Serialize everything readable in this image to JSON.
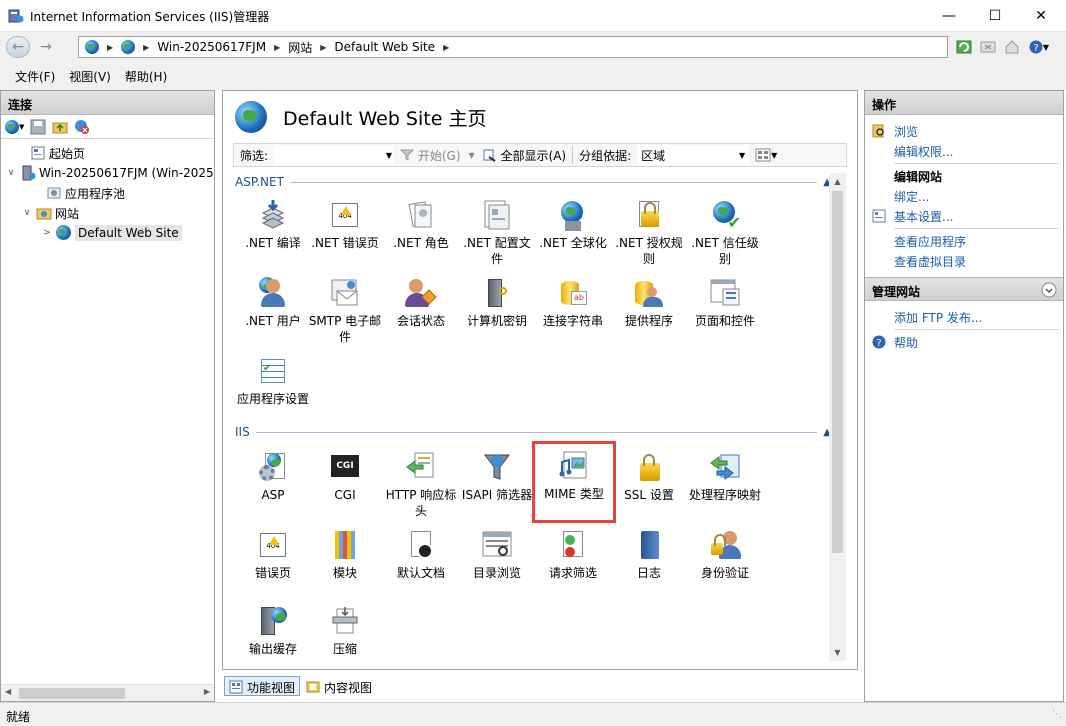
{
  "window": {
    "title": "Internet Information Services (IIS)管理器"
  },
  "address": {
    "crumbs": [
      "Win-20250617FJM",
      "网站",
      "Default Web Site"
    ]
  },
  "menu": [
    "文件(F)",
    "视图(V)",
    "帮助(H)"
  ],
  "connections": {
    "header": "连接",
    "tree": {
      "start": "起始页",
      "server": "Win-20250617FJM (Win-2025",
      "apppools": "应用程序池",
      "sites": "网站",
      "site": "Default Web Site"
    }
  },
  "center": {
    "title": "Default Web Site 主页",
    "filter": {
      "label": "筛选:",
      "start": "开始(G)",
      "showall": "全部显示(A)",
      "groupby": "分组依据:",
      "groupvalue": "区域"
    },
    "groups": {
      "aspnet": "ASP.NET",
      "iis": "IIS"
    },
    "aspnet_items": [
      ".NET 编译",
      ".NET 错误页",
      ".NET 角色",
      ".NET 配置文件",
      ".NET 全球化",
      ".NET 授权规则",
      ".NET 信任级别",
      ".NET 用户",
      "SMTP 电子邮件",
      "会话状态",
      "计算机密钥",
      "连接字符串",
      "提供程序",
      "页面和控件",
      "应用程序设置"
    ],
    "iis_items": [
      "ASP",
      "CGI",
      "HTTP 响应标头",
      "ISAPI 筛选器",
      "MIME 类型",
      "SSL 设置",
      "处理程序映射",
      "错误页",
      "模块",
      "默认文档",
      "目录浏览",
      "请求筛选",
      "日志",
      "身份验证",
      "输出缓存",
      "压缩"
    ],
    "tabs": {
      "features": "功能视图",
      "content": "内容视图"
    }
  },
  "actions": {
    "header": "操作",
    "browse": "浏览",
    "editperm": "编辑权限...",
    "editsite_label": "编辑网站",
    "bindings": "绑定...",
    "basic": "基本设置...",
    "viewapps": "查看应用程序",
    "viewvdirs": "查看虚拟目录",
    "manage_header": "管理网站",
    "addftp": "添加 FTP 发布...",
    "help": "帮助"
  },
  "status": {
    "text": "就绪"
  },
  "colors": {
    "highlight": "#e8423b",
    "link": "#1a5ea8",
    "group": "#1c4f8a"
  }
}
